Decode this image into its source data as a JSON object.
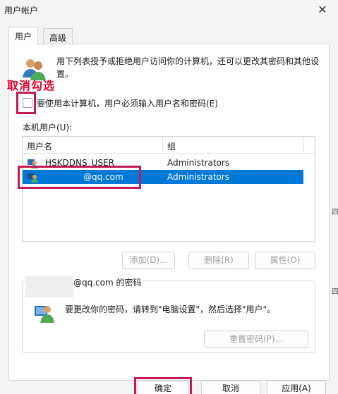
{
  "window": {
    "title": "用户帐户",
    "close_glyph": "✕"
  },
  "tabs": [
    {
      "label": "用户"
    },
    {
      "label": "高级"
    }
  ],
  "description": "用下列表授予或拒绝用户访问你的计算机，还可以更改其密码和其他设置。",
  "annotation": {
    "text": "取消勾选"
  },
  "require_password": {
    "label": "要使用本计算机，用户必须输入用户名和密码(E)",
    "checked": false
  },
  "local_users": {
    "label": "本机用户(U):",
    "columns": [
      "用户名",
      "组"
    ],
    "rows": [
      {
        "name": "HSKDDNS_USER",
        "group": "Administrators",
        "selected": false
      },
      {
        "name": "@qq.com",
        "group": "Administrators",
        "selected": true
      }
    ]
  },
  "list_buttons": {
    "add": "添加(D)...",
    "remove": "删除(R)",
    "properties": "属性(O)"
  },
  "password_section": {
    "title": "@qq.com 的密码",
    "description": "要更改你的密码，请转到\"电脑设置\"，然后选择\"用户\"。",
    "reset_button": "重置密码(P)..."
  },
  "footer": {
    "ok": "确定",
    "cancel": "取消",
    "apply": "应用(A)"
  },
  "edge_chars": [
    "四",
    "四"
  ],
  "colors": {
    "selection": "#0078d7",
    "annotation": "#c21a55",
    "annotation_text": "#e0002a"
  }
}
